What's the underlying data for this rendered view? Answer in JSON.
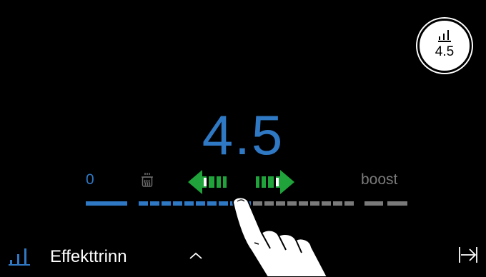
{
  "badge": {
    "icon": "power-level-icon",
    "value": "4.5"
  },
  "display": {
    "value": "4.5"
  },
  "scale": {
    "min_label": "0",
    "max_label": "boost",
    "pot_icon": "pot-steam-icon",
    "level": 0.5
  },
  "controls": {
    "decrease_icon": "arrow-left-icon",
    "increase_icon": "arrow-right-icon"
  },
  "bottom": {
    "icon": "power-level-icon",
    "label": "Effekttrinn",
    "chevron_icon": "chevron-up-icon",
    "end_icon": "arrow-to-end-icon"
  },
  "colors": {
    "accent": "#2f78c4",
    "inactive": "#7a7a7a",
    "arrow_green": "#1fa33a",
    "background": "#000000"
  }
}
